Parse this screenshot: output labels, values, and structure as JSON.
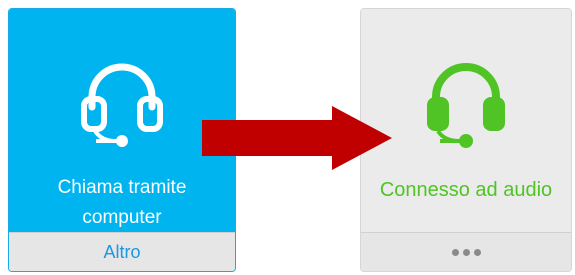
{
  "left_card": {
    "label_line1": "Chiama tramite",
    "label_line2": "computer",
    "footer_link": "Altro",
    "icon": "headset-icon"
  },
  "right_card": {
    "label": "Connesso ad audio",
    "icon": "headset-icon",
    "footer_menu": "more-options-icon"
  },
  "colors": {
    "left_bg": "#00b4f0",
    "right_label": "#4fc424",
    "arrow": "#c00000",
    "link": "#1a98e0"
  }
}
